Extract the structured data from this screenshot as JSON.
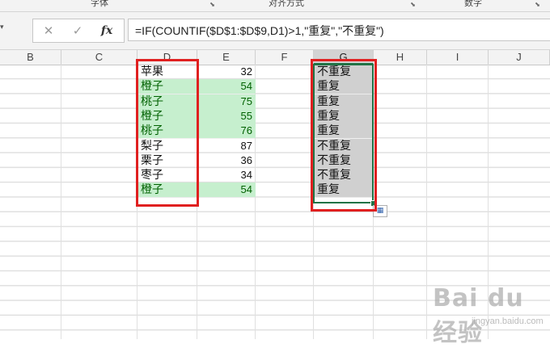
{
  "ribbon": {
    "groups": [
      "字体",
      "对齐方式",
      "数字"
    ]
  },
  "formula_bar": {
    "cancel_icon": "x-icon",
    "enter_icon": "check-icon",
    "fx_label": "fx",
    "formula": "=IF(COUNTIF($D$1:$D$9,D1)>1,\"重复\",\"不重复\")"
  },
  "columns": [
    "B",
    "C",
    "D",
    "E",
    "F",
    "G",
    "H",
    "I",
    "J"
  ],
  "selected_column": "G",
  "rows": [
    {
      "d": "苹果",
      "e": "32",
      "g": "不重复",
      "dup": false
    },
    {
      "d": "橙子",
      "e": "54",
      "g": "重复",
      "dup": true
    },
    {
      "d": "桃子",
      "e": "75",
      "g": "重复",
      "dup": true
    },
    {
      "d": "橙子",
      "e": "55",
      "g": "重复",
      "dup": true
    },
    {
      "d": "桃子",
      "e": "76",
      "g": "重复",
      "dup": true
    },
    {
      "d": "梨子",
      "e": "87",
      "g": "不重复",
      "dup": false
    },
    {
      "d": "栗子",
      "e": "36",
      "g": "不重复",
      "dup": false
    },
    {
      "d": "枣子",
      "e": "34",
      "g": "不重复",
      "dup": false
    },
    {
      "d": "橙子",
      "e": "54",
      "g": "重复",
      "dup": true
    }
  ],
  "colors": {
    "duplicate_fill": "#c6efce",
    "duplicate_text": "#006100",
    "annotation_box": "#e02020",
    "selection": "#217346"
  },
  "watermark": {
    "main": "Bai du 经验",
    "sub": "jingyan.baidu.com"
  }
}
